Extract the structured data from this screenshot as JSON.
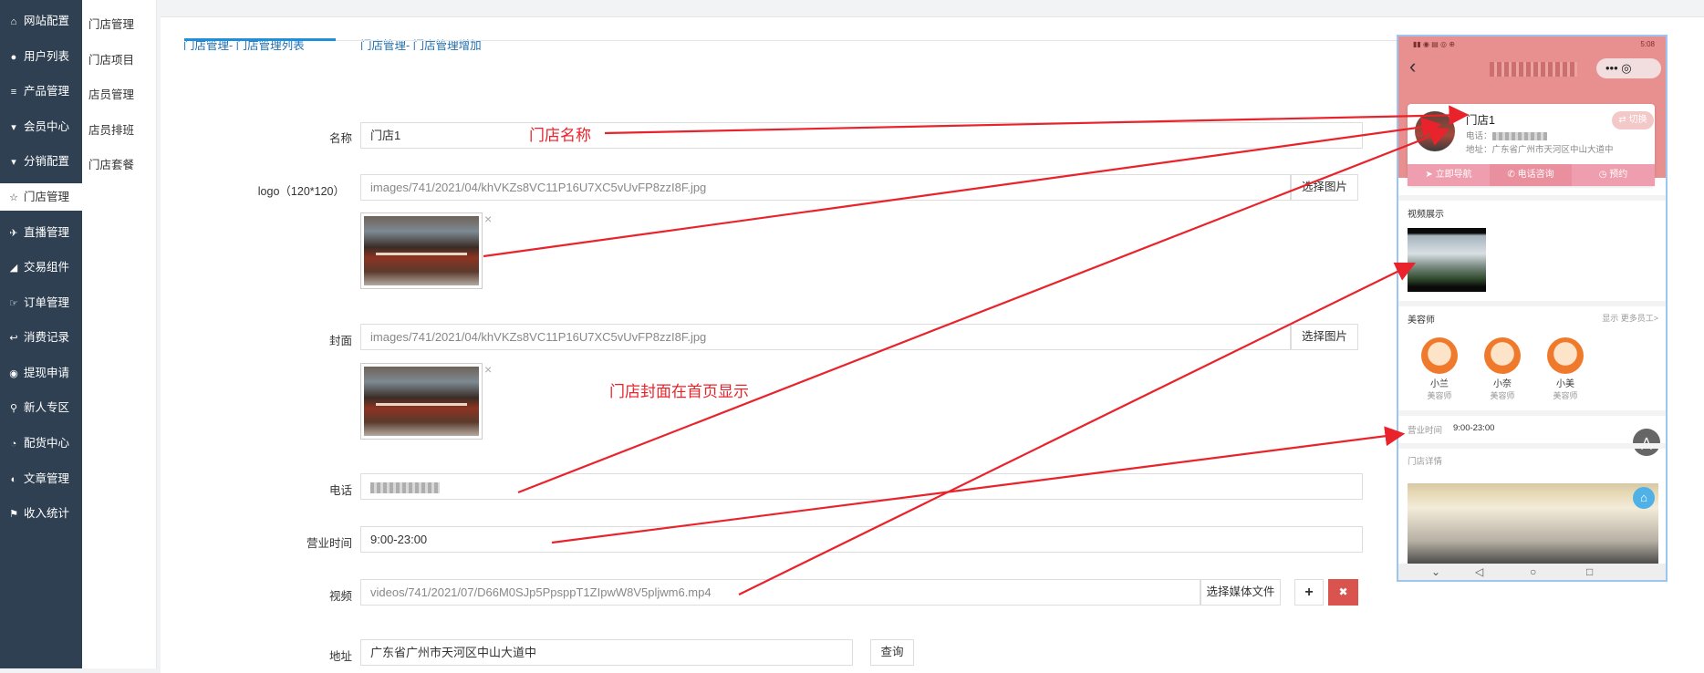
{
  "sidebar": {
    "items": [
      {
        "icon": "home-icon",
        "glyph": "⌂",
        "label": "网站配置"
      },
      {
        "icon": "user-icon",
        "glyph": "●",
        "label": "用户列表"
      },
      {
        "icon": "list-icon",
        "glyph": "≡",
        "label": "产品管理"
      },
      {
        "icon": "cart-icon",
        "glyph": "▾",
        "label": "会员中心"
      },
      {
        "icon": "cart-icon",
        "glyph": "▾",
        "label": "分销配置"
      },
      {
        "icon": "star-icon",
        "glyph": "☆",
        "label": "门店管理"
      },
      {
        "icon": "plane-icon",
        "glyph": "✈",
        "label": "直播管理"
      },
      {
        "icon": "eraser-icon",
        "glyph": "◢",
        "label": "交易组件"
      },
      {
        "icon": "thumb-icon",
        "glyph": "☞",
        "label": "订单管理"
      },
      {
        "icon": "reply-icon",
        "glyph": "↩",
        "label": "消费记录"
      },
      {
        "icon": "wechat-icon",
        "glyph": "◉",
        "label": "提现申请"
      },
      {
        "icon": "pin-icon",
        "glyph": "⚲",
        "label": "新人专区"
      },
      {
        "icon": "pie-icon",
        "glyph": "◔",
        "label": "配货中心"
      },
      {
        "icon": "contrast-icon",
        "glyph": "◐",
        "label": "文章管理"
      },
      {
        "icon": "flag-icon",
        "glyph": "⚑",
        "label": "收入统计"
      }
    ],
    "active_index": 5
  },
  "subnav": {
    "items": [
      "门店管理",
      "门店项目",
      "店员管理",
      "店员排班",
      "门店套餐"
    ]
  },
  "tabs": [
    {
      "label": "门店管理- 门店管理列表"
    },
    {
      "label": "门店管理- 门店管理增加"
    }
  ],
  "form": {
    "name_label": "名称",
    "name_value": "门店1",
    "logo_label": "logo（120*120）",
    "logo_value": "images/741/2021/04/khVKZs8VC11P16U7XC5vUvFP8zzI8F.jpg",
    "logo_button": "选择图片",
    "cover_label": "封面",
    "cover_value": "images/741/2021/04/khVKZs8VC11P16U7XC5vUvFP8zzI8F.jpg",
    "cover_button": "选择图片",
    "phone_label": "电话",
    "hours_label": "营业时间",
    "hours_value": "9:00-23:00",
    "video_label": "视频",
    "video_value": "videos/741/2021/07/D66M0SJp5PpsppT1ZIpwW8V5pljwm6.mp4",
    "video_button": "选择媒体文件",
    "video_add": "+",
    "video_remove": "✖",
    "address_label": "地址",
    "address_value": "广东省广州市天河区中山大道中",
    "address_button": "查询",
    "remove_mark": "×"
  },
  "annotations": {
    "store_name": "门店名称",
    "cover_note": "门店封面在首页显示"
  },
  "phone_preview": {
    "status_time": "5:08",
    "back_icon": "‹",
    "capsule": "••• ◎",
    "store_name": "门店1",
    "phone_prefix": "电话：",
    "address": "地址：广东省广州市天河区中山大道中",
    "switch_label": "切换",
    "btn_nav": "立即导航",
    "btn_call": "电话咨询",
    "btn_book": "预约",
    "video_section": "视频展示",
    "staff_section": "美容师",
    "staff_more": "显示 更多员工>",
    "staff": [
      {
        "name": "小兰",
        "role": "美容师"
      },
      {
        "name": "小奈",
        "role": "美容师"
      },
      {
        "name": "小美",
        "role": "美容师"
      }
    ],
    "hours_label": "营业时间",
    "hours_value": "9:00-23:00",
    "detail_section": "门店详情"
  },
  "colors": {
    "sidebar_bg": "#2f4052",
    "tab_active": "#1e8fd9",
    "annotation_red": "#e8232b",
    "remove_button": "#d9534f",
    "phone_header": "#e88f8f"
  }
}
